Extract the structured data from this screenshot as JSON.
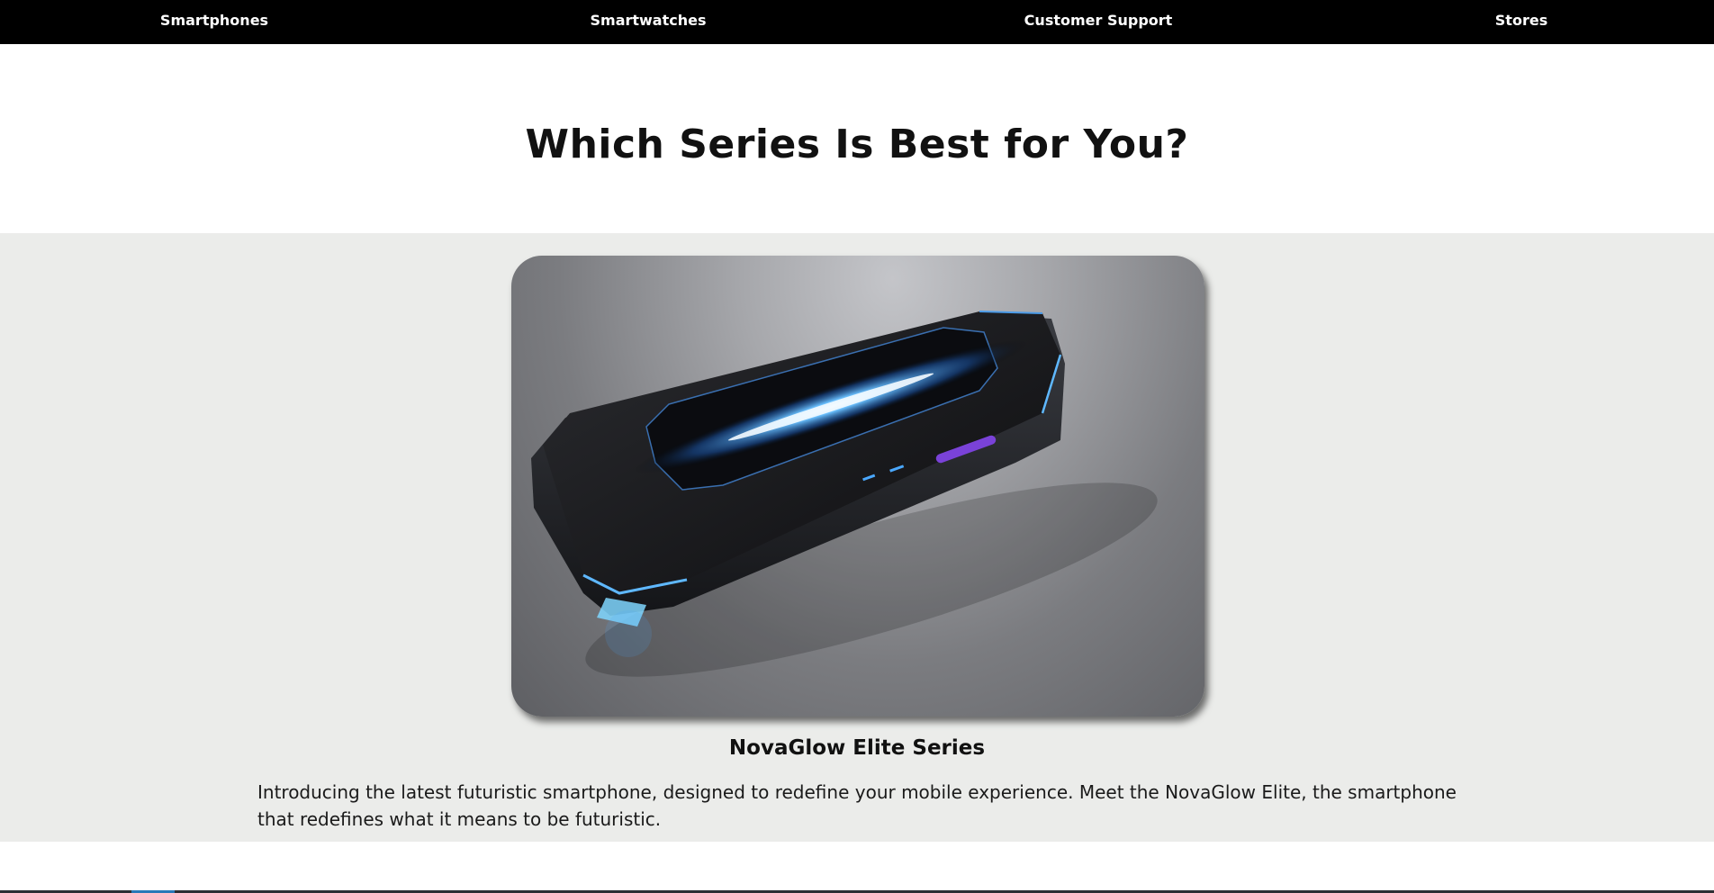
{
  "nav": {
    "items": [
      {
        "label": "Smartphones"
      },
      {
        "label": "Smartwatches"
      },
      {
        "label": "Customer Support"
      },
      {
        "label": "Stores"
      }
    ]
  },
  "hero": {
    "title": "Which Series Is Best for You?"
  },
  "series": {
    "image_alt": "futuristic smartphone",
    "title": "NovaGlow Elite Series",
    "description": "Introducing the latest futuristic smartphone, designed to redefine your mobile experience. Meet the NovaGlow Elite, the smartphone that redefines what it means to be futuristic."
  },
  "colors": {
    "nav_bg": "#000000",
    "section_bg": "#ebecea",
    "glow": "#4aa8ff"
  }
}
